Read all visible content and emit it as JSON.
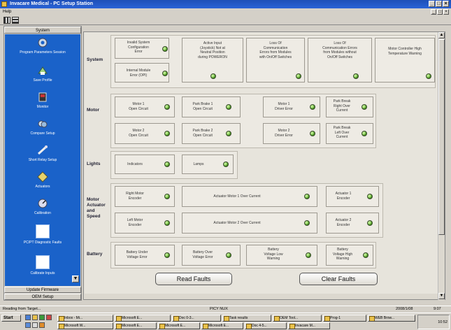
{
  "window": {
    "title": "Invacare Medical - PC Setup Station",
    "min": "_",
    "max": "□",
    "close": "×"
  },
  "menu": {
    "help": "Help"
  },
  "sidebar": {
    "header": "System",
    "items": [
      {
        "label": "Program Parameters Session",
        "icon": "gear-icon"
      },
      {
        "label": "Save Profile",
        "icon": "save-profile-icon"
      },
      {
        "label": "Monitor",
        "icon": "monitor-icon"
      },
      {
        "label": "Compare Setup",
        "icon": "compare-icon"
      },
      {
        "label": "Short Relay Setup",
        "icon": "relay-icon"
      },
      {
        "label": "Actuators",
        "icon": "actuators-icon"
      },
      {
        "label": "Calibration",
        "icon": "calibration-icon"
      },
      {
        "label": "PC/PT Diagnostic Faults",
        "icon": "diagnostic-faults-icon"
      },
      {
        "label": "Calibrate Inputs",
        "icon": "calibrate-inputs-icon"
      }
    ],
    "footers": [
      "Update Firmware",
      "OEM Setup"
    ]
  },
  "sections": {
    "system": "System",
    "motor": "Motor",
    "lights": "Lights",
    "motor_actuator": "Motor\nActuator\nand\nSpeed",
    "battery": "Battery"
  },
  "faults": {
    "invalid_config": "Invalid System\nConfiguration\nError",
    "internal_module": "Internal Module\nError (OPI)",
    "active_input": "Active Input\n(Joystick) Not at\nNeutral Position\nduring POWERON",
    "loss_comm_switch": "Loss Of\nCommunication\nErrors from Modules\nwith On/Off Switches",
    "loss_comm_noswitch": "Loss Of\nCommunication Errors\nfrom Modules without\nOn/Off Switches",
    "motor_ctrl_temp": "Motor Controller High\nTemperature Warning",
    "motor1_open": "Motor 1\nOpen Circuit",
    "park_brake1_open": "Park Brake 1\nOpen Circuit",
    "motor1_driver": "Motor 1\nDriver Error",
    "park_brake_right": "Park Break\nRight Over\nCurrent",
    "motor2_open": "Motor 2\nOpen Circuit",
    "park_brake2_open": "Park Brake 2\nOpen Circuit",
    "motor2_driver": "Motor 2\nDriver Error",
    "park_brake_left": "Park Break\nLeft Over\nCurrent",
    "indicators": "Indicators",
    "lamps": "Lamps",
    "right_motor_encoder": "Right Motor\nEncoder",
    "act_motor1_over": "Actuator Motor 1 Over Current",
    "actuator1_encoder": "Actuator 1\nEncoder",
    "left_motor_encoder": "Left Motor\nEncoder",
    "act_motor2_over": "Actuator Motor 2 Over Current",
    "actuator2_encoder": "Actuator 2\nEncoder",
    "battery_under": "Battery Under\nVoltage Error",
    "battery_over": "Battery Over\nVoltage Error",
    "battery_low": "Battery\nVoltage Low\nWarning",
    "battery_high": "Battery\nVoltage High\nWarning"
  },
  "buttons": {
    "read_faults": "Read Faults",
    "clear_faults": "Clear Faults"
  },
  "status": {
    "left": "Reading from Target...",
    "mid": "PICY  NUX",
    "r1": "2008/1/08",
    "r2": "9:07"
  },
  "taskbar": {
    "start": "Start",
    "tasks": [
      "Inbox - Mi...",
      "Microsoft E...",
      "Doc 0-3...",
      "Task results",
      "OEM Tool...",
      "Prog-1",
      "WEB Brow...",
      "Microsoft W...",
      "Microsoft E...",
      "Microsoft E...",
      "Microsoft E...",
      "Doc 4-5...",
      "Invacare M..."
    ],
    "clock": "10:52"
  },
  "colors": {
    "sidebar": "#1a62c9",
    "led_green": "#4c9a22",
    "title": "#1d4fb8"
  }
}
